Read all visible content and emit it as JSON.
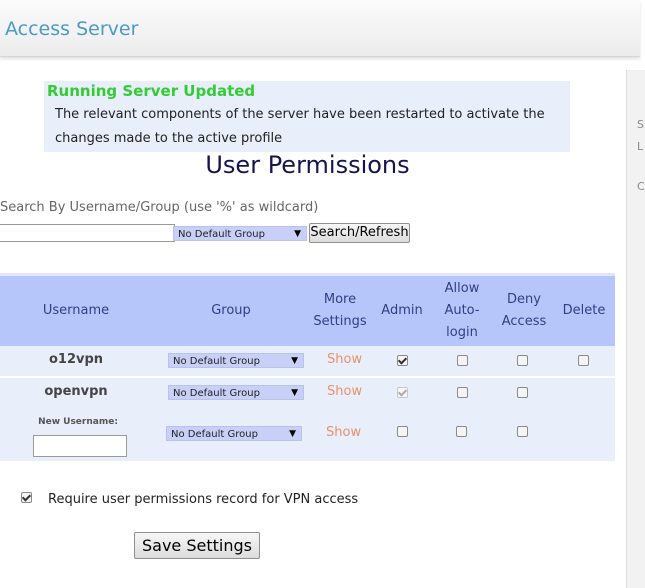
{
  "app": {
    "title": "Access Server"
  },
  "notice": {
    "title": "Running Server Updated",
    "message": "The relevant components of the server have been restarted to activate the changes made to the active profile"
  },
  "page_title": "User Permissions",
  "search": {
    "label": "Search By Username/Group (use '%' as wildcard)",
    "value": "",
    "group_select": "No Default Group",
    "button": "Search/Refresh"
  },
  "table": {
    "headers": {
      "username": "Username",
      "group": "Group",
      "more_settings": "More Settings",
      "admin": "Admin",
      "allow_autologin": "Allow Auto-login",
      "deny_access": "Deny Access",
      "delete": "Delete"
    },
    "rows": [
      {
        "username": "o12vpn",
        "group": "No Default Group",
        "show": "Show",
        "admin": true,
        "autologin": false,
        "deny": false,
        "delete": false
      },
      {
        "username": "openvpn",
        "group": "No Default Group",
        "show": "Show",
        "admin": true,
        "autologin": false,
        "deny": false
      }
    ],
    "new_user": {
      "label": "New Username:",
      "value": "",
      "group": "No Default Group",
      "show": "Show",
      "admin": false,
      "autologin": false,
      "deny": false
    }
  },
  "require_record": {
    "checked": true,
    "label": "Require user permissions record for VPN access"
  },
  "save_button": "Save Settings",
  "right_panel": {
    "letters": [
      "S",
      "L",
      "C"
    ]
  },
  "colors": {
    "header_bg": "#b7c6fa",
    "row_bg": "#e9eefb",
    "title": "#14144e",
    "brand": "#4b9ac4",
    "notice_title": "#33cc33",
    "select_bg": "#c8d0f8",
    "link": "#e8926a"
  }
}
